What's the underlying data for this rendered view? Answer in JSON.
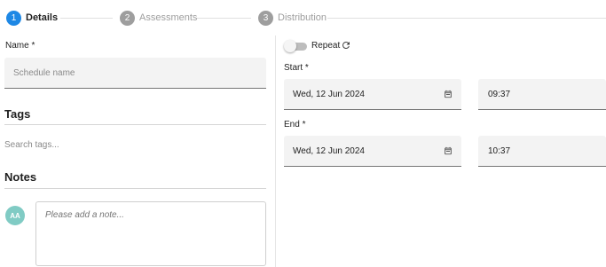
{
  "stepper": {
    "steps": [
      {
        "number": "1",
        "label": "Details"
      },
      {
        "number": "2",
        "label": "Assessments"
      },
      {
        "number": "3",
        "label": "Distribution"
      }
    ],
    "active_step": 1
  },
  "details": {
    "name_label": "Name *",
    "name_placeholder": "Schedule name",
    "name_value": "",
    "tags_title": "Tags",
    "tags_placeholder": "Search tags...",
    "notes_title": "Notes",
    "avatar_initials": "AA",
    "note_placeholder": "Please add a note..."
  },
  "schedule": {
    "repeat_label": "Repeat",
    "repeat_enabled": false,
    "start_label": "Start *",
    "start_date": "Wed, 12 Jun 2024",
    "start_time": "09:37",
    "end_label": "End *",
    "end_date": "Wed, 12 Jun 2024",
    "end_time": "10:37"
  },
  "icons": {
    "repeat": "repeat-icon",
    "calendar": "calendar-icon"
  },
  "colors": {
    "active_step": "#1e88e5",
    "inactive_step": "#9e9e9e",
    "avatar": "#80cbc4",
    "field_bg": "#f3f3f3"
  }
}
